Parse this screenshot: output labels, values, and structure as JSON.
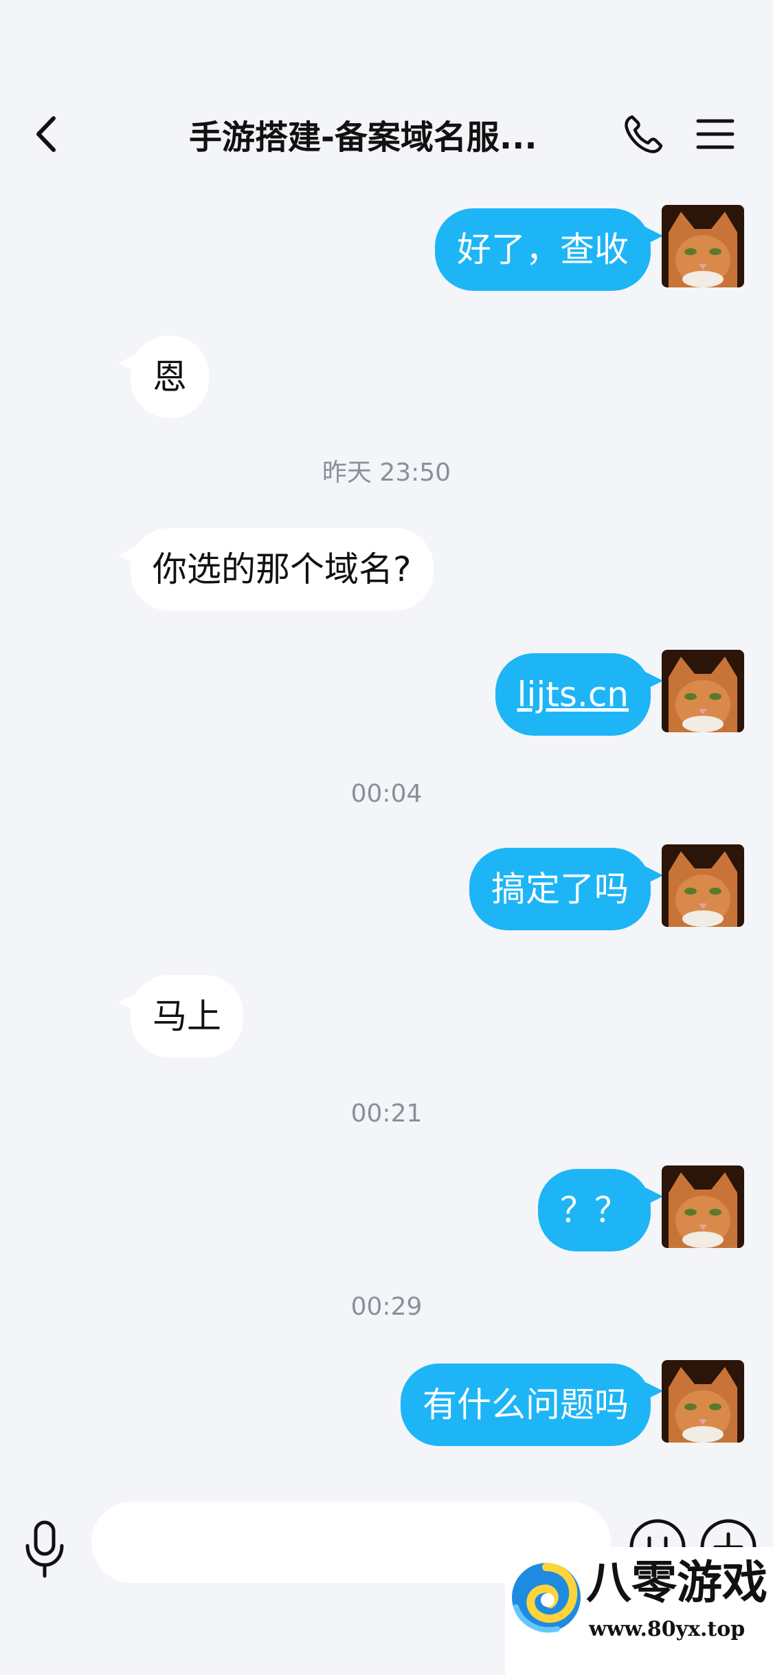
{
  "header": {
    "title": "手游搭建-备案域名服...",
    "back_icon": "chevron-left-icon",
    "call_icon": "phone-icon",
    "menu_icon": "hamburger-menu-icon"
  },
  "messages": [
    {
      "type": "out",
      "text": "好了，查收"
    },
    {
      "type": "in",
      "text": "恩"
    },
    {
      "type": "time",
      "text": "昨天 23:50"
    },
    {
      "type": "in",
      "text": "你选的那个域名?"
    },
    {
      "type": "out",
      "text": "lijts.cn",
      "is_link": true
    },
    {
      "type": "time",
      "text": "00:04"
    },
    {
      "type": "out",
      "text": "搞定了吗"
    },
    {
      "type": "in",
      "text": "马上"
    },
    {
      "type": "time",
      "text": "00:21"
    },
    {
      "type": "out",
      "text": "？？"
    },
    {
      "type": "time",
      "text": "00:29"
    },
    {
      "type": "out",
      "text": "有什么问题吗"
    }
  ],
  "input": {
    "placeholder": "",
    "value": "",
    "mic_icon": "microphone-icon",
    "emoji_icon": "emoji-icon",
    "plus_icon": "plus-icon"
  },
  "watermark": {
    "title": "八零游戏",
    "url": "www.80yx.top"
  },
  "colors": {
    "background": "#f3f5f9",
    "outgoing_bubble": "#1db5f6",
    "incoming_bubble": "#ffffff",
    "timestamp_text": "#8a8f99"
  }
}
